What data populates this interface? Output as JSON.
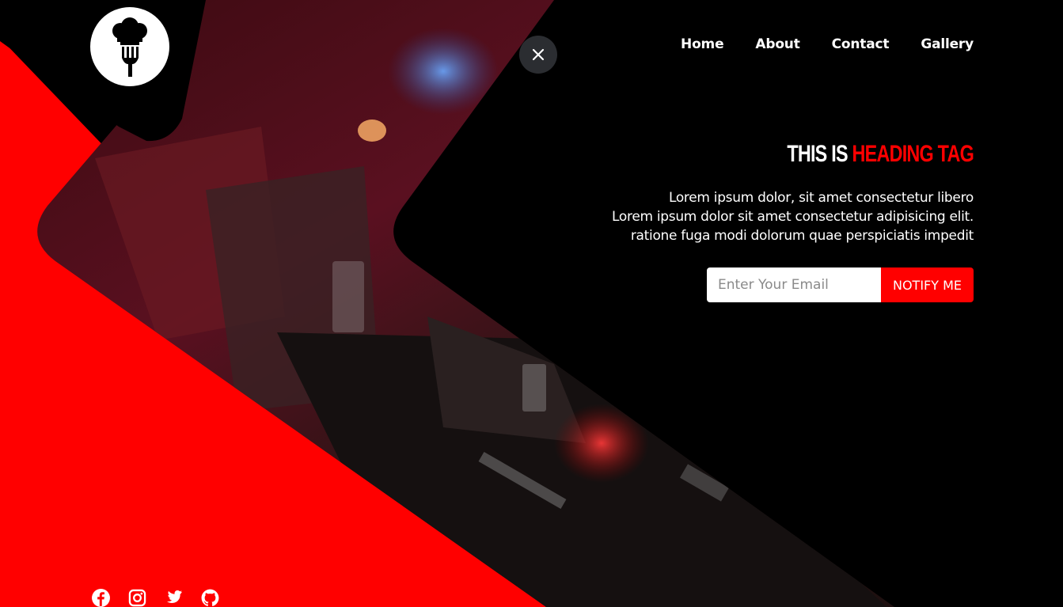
{
  "nav": {
    "items": [
      {
        "label": "Home"
      },
      {
        "label": "About"
      },
      {
        "label": "Contact"
      },
      {
        "label": "Gallery"
      }
    ]
  },
  "hero": {
    "heading_part1": "THIS IS",
    "heading_part2": "HEADING TAG",
    "desc_line1": "Lorem ipsum dolor, sit amet consectetur libero",
    "desc_line2": "Lorem ipsum dolor sit amet consectetur adipisicing elit.",
    "desc_line3": "ratione fuga modi dolorum quae perspiciatis impedit"
  },
  "form": {
    "email_placeholder": "Enter Your Email",
    "email_value": "",
    "notify_label": "NOTIFY ME"
  },
  "icons": {
    "logo": "chef-fork-icon",
    "close": "close-icon",
    "socials": [
      "facebook-icon",
      "instagram-icon",
      "twitter-icon",
      "github-icon"
    ]
  },
  "colors": {
    "accent": "#ff0000",
    "background": "#000000",
    "close_button_bg": "#2b2d31"
  }
}
